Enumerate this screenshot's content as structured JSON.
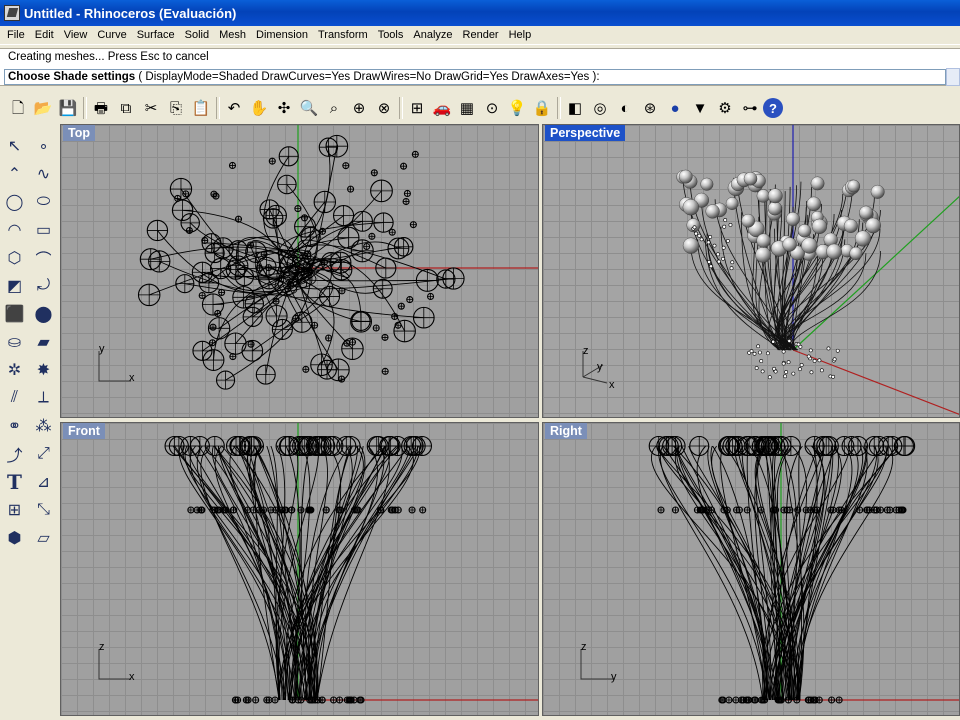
{
  "window": {
    "title": "Untitled - Rhinoceros (Evaluación)"
  },
  "menu": [
    "File",
    "Edit",
    "View",
    "Curve",
    "Surface",
    "Solid",
    "Mesh",
    "Dimension",
    "Transform",
    "Tools",
    "Analyze",
    "Render",
    "Help"
  ],
  "command": {
    "history": "Creating meshes... Press Esc to cancel",
    "prompt_label": "Choose Shade settings",
    "options": "( DisplayMode=Shaded  DrawCurves=Yes  DrawWires=No  DrawGrid=Yes  DrawAxes=Yes ):"
  },
  "toolbar_icons": [
    "new-icon",
    "open-icon",
    "save-icon",
    "print-icon",
    "import-icon",
    "cut-icon",
    "copy-icon",
    "paste-icon",
    "undo-icon",
    "pan-icon",
    "rotate-view-icon",
    "zoom-icon",
    "zoom-window-icon",
    "zoom-extents-icon",
    "zoom-selected-icon",
    "four-viewports-icon",
    "car-icon",
    "grid-icon",
    "point-icon",
    "light-icon",
    "lock-icon",
    "shade-icon",
    "color-wheel-icon",
    "sphere-half-icon",
    "wire-sphere-icon",
    "render-icon",
    "paint-icon",
    "settings-icon",
    "layout-icon",
    "help-icon"
  ],
  "left_tools": [
    "select-arrow-icon",
    "point-icon",
    "polyline-icon",
    "curve-icon",
    "circle-icon",
    "ellipse-icon",
    "arc-icon",
    "rectangle-icon",
    "polygon-icon",
    "fillet-icon",
    "surface-icon",
    "sweep-icon",
    "box-icon",
    "sphere-icon",
    "cylinder-icon",
    "patch-icon",
    "gear-icon",
    "explode-icon",
    "split-icon",
    "extend-icon",
    "boolean-icon",
    "array-icon",
    "curve-tool-icon",
    "offset-icon",
    "text-icon",
    "dimension-icon",
    "group-icon",
    "transform-icon",
    "mesh-icon",
    "plane-icon"
  ],
  "viewports": {
    "top": {
      "label": "Top",
      "axis_a": "y",
      "axis_b": "x"
    },
    "perspective": {
      "label": "Perspective",
      "axis_z": "z",
      "axis_a": "y",
      "axis_b": "x"
    },
    "front": {
      "label": "Front",
      "axis_a": "z",
      "axis_b": "x"
    },
    "right": {
      "label": "Right",
      "axis_a": "z",
      "axis_b": "y"
    }
  },
  "colors": {
    "title_bar": "#0a5fd8",
    "viewport_bg": "#a0a0a0",
    "active_label": "#1e52c8",
    "x_axis": "#b02020",
    "y_axis": "#20a020",
    "z_axis": "#2020b0"
  }
}
